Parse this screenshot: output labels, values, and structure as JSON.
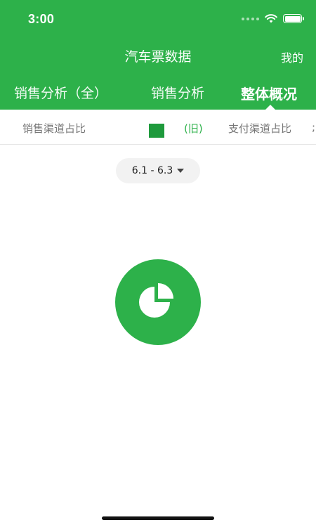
{
  "status_bar": {
    "time": "3:00",
    "icons": [
      "signal-dots-icon",
      "wifi-icon",
      "battery-icon"
    ]
  },
  "nav": {
    "title": "汽车票数据",
    "mine_label": "我的"
  },
  "top_tabs": [
    {
      "label": "销售分析（全）",
      "active": false
    },
    {
      "label": "销售分析",
      "active": false
    },
    {
      "label": "整体概况",
      "active": true
    }
  ],
  "sub_tabs": [
    {
      "label": "销售渠道占比",
      "active": false
    },
    {
      "label": "(旧)",
      "active": true
    },
    {
      "label": "支付渠道占比",
      "active": false
    },
    {
      "label": ";",
      "active": false
    }
  ],
  "date_filter": {
    "label": "6.1 - 6.3"
  },
  "empty_state": {
    "icon": "pie-chart-icon"
  },
  "colors": {
    "primary": "#2db14a",
    "text_muted": "#777777",
    "pill_bg": "#f2f2f2"
  }
}
